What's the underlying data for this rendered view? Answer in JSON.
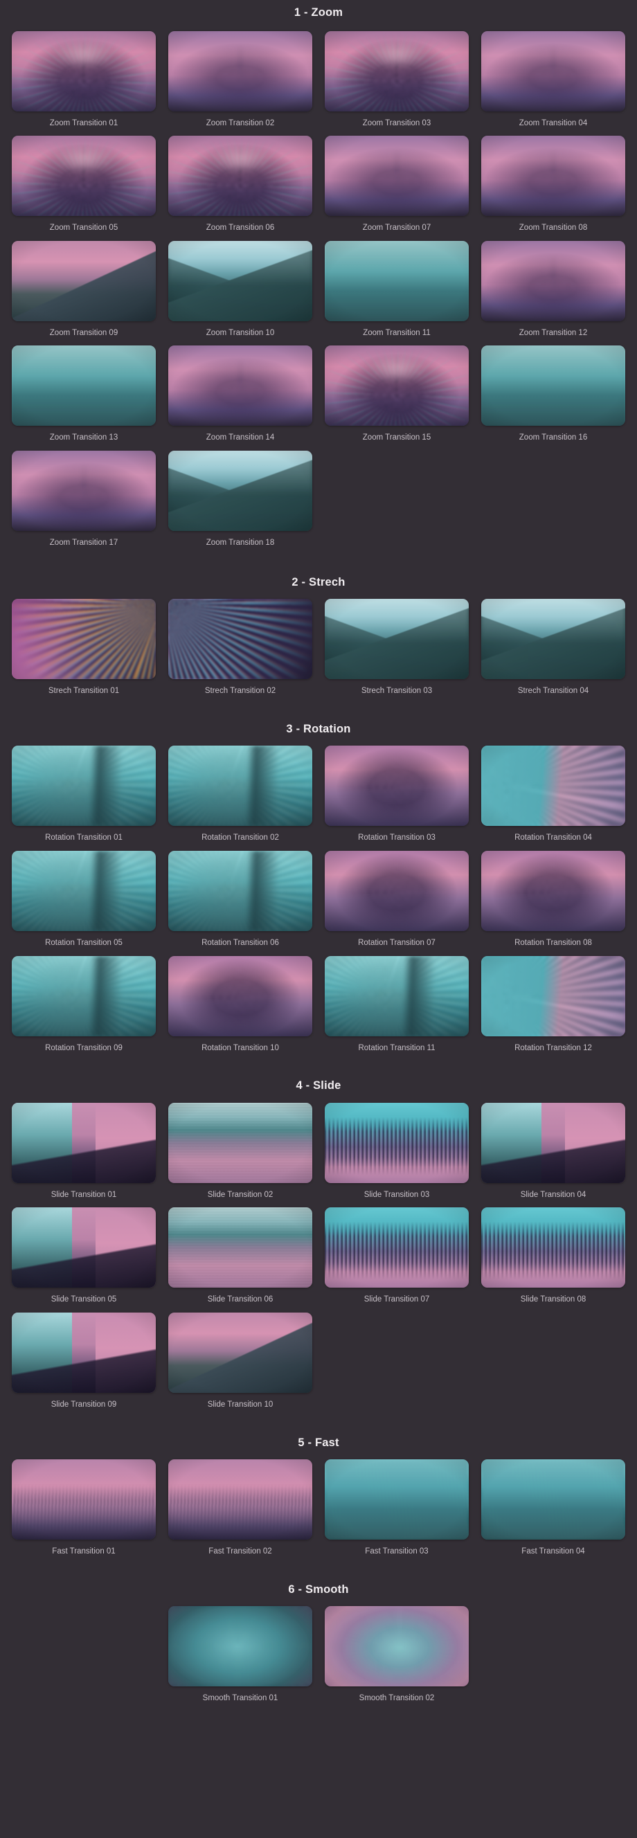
{
  "theme": {
    "background": "#332e35",
    "section_title_color": "#f2eef1",
    "label_color": "#c8c1c8"
  },
  "sections": [
    {
      "id": "zoom",
      "title": "1 - Zoom",
      "items": [
        {
          "label": "Zoom Transition 01",
          "art": "zoom-burst"
        },
        {
          "label": "Zoom Transition 02",
          "art": "zoom-soft"
        },
        {
          "label": "Zoom Transition 03",
          "art": "zoom-burst"
        },
        {
          "label": "Zoom Transition 04",
          "art": "zoom-soft"
        },
        {
          "label": "Zoom Transition 05",
          "art": "zoom-burst"
        },
        {
          "label": "Zoom Transition 06",
          "art": "zoom-burst"
        },
        {
          "label": "Zoom Transition 07",
          "art": "zoom-soft"
        },
        {
          "label": "Zoom Transition 08",
          "art": "zoom-soft"
        },
        {
          "label": "Zoom Transition 09",
          "art": "mountain-pink"
        },
        {
          "label": "Zoom Transition 10",
          "art": "mountain"
        },
        {
          "label": "Zoom Transition 11",
          "art": "streak-h"
        },
        {
          "label": "Zoom Transition 12",
          "art": "zoom-soft"
        },
        {
          "label": "Zoom Transition 13",
          "art": "streak-h"
        },
        {
          "label": "Zoom Transition 14",
          "art": "zoom-soft"
        },
        {
          "label": "Zoom Transition 15",
          "art": "zoom-burst"
        },
        {
          "label": "Zoom Transition 16",
          "art": "streak-h"
        },
        {
          "label": "Zoom Transition 17",
          "art": "zoom-soft"
        },
        {
          "label": "Zoom Transition 18",
          "art": "mountain"
        }
      ]
    },
    {
      "id": "strech",
      "title": "2 - Strech",
      "items": [
        {
          "label": "Strech Transition 01",
          "art": "stretch-diag"
        },
        {
          "label": "Strech Transition 02",
          "art": "stretch-diag2"
        },
        {
          "label": "Strech Transition 03",
          "art": "mountain"
        },
        {
          "label": "Strech Transition 04",
          "art": "mountain"
        }
      ]
    },
    {
      "id": "rotation",
      "title": "3 - Rotation",
      "items": [
        {
          "label": "Rotation Transition 01",
          "art": "rot-teal"
        },
        {
          "label": "Rotation Transition 02",
          "art": "rot-teal"
        },
        {
          "label": "Rotation Transition 03",
          "art": "rot-dark"
        },
        {
          "label": "Rotation Transition 04",
          "art": "rot-split"
        },
        {
          "label": "Rotation Transition 05",
          "art": "rot-teal"
        },
        {
          "label": "Rotation Transition 06",
          "art": "rot-teal"
        },
        {
          "label": "Rotation Transition 07",
          "art": "rot-dark"
        },
        {
          "label": "Rotation Transition 08",
          "art": "rot-dark"
        },
        {
          "label": "Rotation Transition 09",
          "art": "rot-teal"
        },
        {
          "label": "Rotation Transition 10",
          "art": "rot-dark"
        },
        {
          "label": "Rotation Transition 11",
          "art": "rot-teal"
        },
        {
          "label": "Rotation Transition 12",
          "art": "rot-split"
        }
      ]
    },
    {
      "id": "slide",
      "title": "4 - Slide",
      "items": [
        {
          "label": "Slide Transition 01",
          "art": "slide-v"
        },
        {
          "label": "Slide Transition 02",
          "art": "slide-h"
        },
        {
          "label": "Slide Transition 03",
          "art": "slide-smear"
        },
        {
          "label": "Slide Transition 04",
          "art": "slide-v"
        },
        {
          "label": "Slide Transition 05",
          "art": "slide-v"
        },
        {
          "label": "Slide Transition 06",
          "art": "slide-h"
        },
        {
          "label": "Slide Transition 07",
          "art": "slide-smear"
        },
        {
          "label": "Slide Transition 08",
          "art": "slide-smear"
        },
        {
          "label": "Slide Transition 09",
          "art": "slide-v"
        },
        {
          "label": "Slide Transition 10",
          "art": "mountain-pink"
        }
      ]
    },
    {
      "id": "fast",
      "title": "5 - Fast",
      "items": [
        {
          "label": "Fast Transition 01",
          "art": "fast-pink"
        },
        {
          "label": "Fast Transition 02",
          "art": "fast-pink"
        },
        {
          "label": "Fast Transition 03",
          "art": "fast-teal"
        },
        {
          "label": "Fast Transition 04",
          "art": "fast-teal"
        }
      ]
    },
    {
      "id": "smooth",
      "title": "6 - Smooth",
      "items": [
        {
          "label": "Smooth Transition 01",
          "art": "smooth-teal"
        },
        {
          "label": "Smooth Transition 02",
          "art": "smooth-pink"
        }
      ]
    }
  ]
}
